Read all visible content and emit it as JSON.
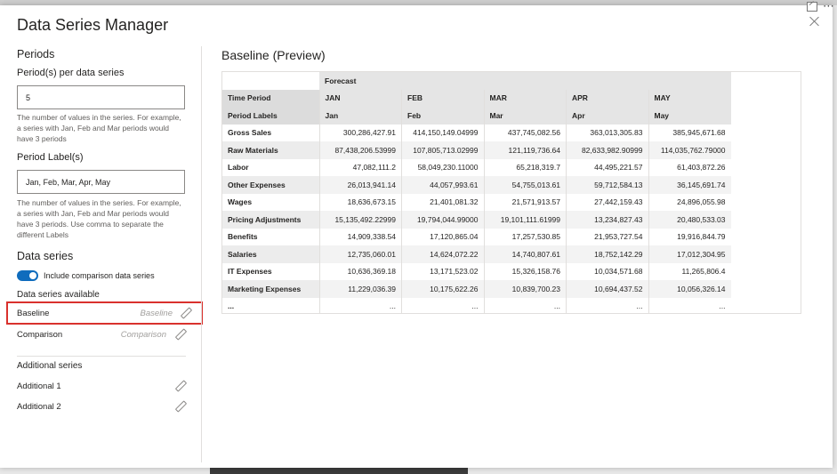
{
  "window": {
    "title": "Data Series Manager"
  },
  "periods": {
    "heading": "Periods",
    "per_series_label": "Period(s) per data series",
    "per_series_value": "5",
    "per_series_help": "The number of values in the series. For example, a series with Jan, Feb and Mar periods would have 3 periods",
    "labels_label": "Period Label(s)",
    "labels_value": "Jan, Feb, Mar, Apr, May",
    "labels_help": "The number of values in the series. For example, a series with Jan, Feb and Mar periods would have 3 periods. Use comma to separate the different Labels"
  },
  "data_series": {
    "heading": "Data series",
    "toggle_label": "Include comparison data series",
    "toggle_on": true,
    "available_label": "Data series available",
    "items": [
      {
        "name": "Baseline",
        "alias": "Baseline"
      },
      {
        "name": "Comparison",
        "alias": "Comparison"
      }
    ],
    "additional_label": "Additional series",
    "additional": [
      {
        "name": "Additional 1"
      },
      {
        "name": "Additional 2"
      }
    ]
  },
  "preview": {
    "title": "Baseline (Preview)",
    "group_header": "Forecast",
    "time_period_label": "Time Period",
    "period_labels_label": "Period Labels",
    "columns": [
      "JAN",
      "FEB",
      "MAR",
      "APR",
      "MAY"
    ],
    "labels": [
      "Jan",
      "Feb",
      "Mar",
      "Apr",
      "May"
    ],
    "rows": [
      {
        "name": "Gross Sales",
        "values": [
          "300,286,427.91",
          "414,150,149.04999",
          "437,745,082.56",
          "363,013,305.83",
          "385,945,671.68"
        ]
      },
      {
        "name": "Raw Materials",
        "values": [
          "87,438,206.53999",
          "107,805,713.02999",
          "121,119,736.64",
          "82,633,982.90999",
          "114,035,762.79000"
        ]
      },
      {
        "name": "Labor",
        "values": [
          "47,082,111.2",
          "58,049,230.11000",
          "65,218,319.7",
          "44,495,221.57",
          "61,403,872.26"
        ]
      },
      {
        "name": "Other Expenses",
        "values": [
          "26,013,941.14",
          "44,057,993.61",
          "54,755,013.61",
          "59,712,584.13",
          "36,145,691.74"
        ]
      },
      {
        "name": "Wages",
        "values": [
          "18,636,673.15",
          "21,401,081.32",
          "21,571,913.57",
          "27,442,159.43",
          "24,896,055.98"
        ]
      },
      {
        "name": "Pricing Adjustments",
        "values": [
          "15,135,492.22999",
          "19,794,044.99000",
          "19,101,111.61999",
          "13,234,827.43",
          "20,480,533.03"
        ]
      },
      {
        "name": "Benefits",
        "values": [
          "14,909,338.54",
          "17,120,865.04",
          "17,257,530.85",
          "21,953,727.54",
          "19,916,844.79"
        ]
      },
      {
        "name": "Salaries",
        "values": [
          "12,735,060.01",
          "14,624,072.22",
          "14,740,807.61",
          "18,752,142.29",
          "17,012,304.95"
        ]
      },
      {
        "name": "IT Expenses",
        "values": [
          "10,636,369.18",
          "13,171,523.02",
          "15,326,158.76",
          "10,034,571.68",
          "11,265,806.4"
        ]
      },
      {
        "name": "Marketing Expenses",
        "values": [
          "11,229,036.39",
          "10,175,622.26",
          "10,839,700.23",
          "10,694,437.52",
          "10,056,326.14"
        ]
      },
      {
        "name": "...",
        "values": [
          "...",
          "...",
          "...",
          "...",
          "..."
        ]
      }
    ]
  },
  "colors": {
    "accent": "#0f6cbd",
    "selection_outline": "#d9312d"
  }
}
